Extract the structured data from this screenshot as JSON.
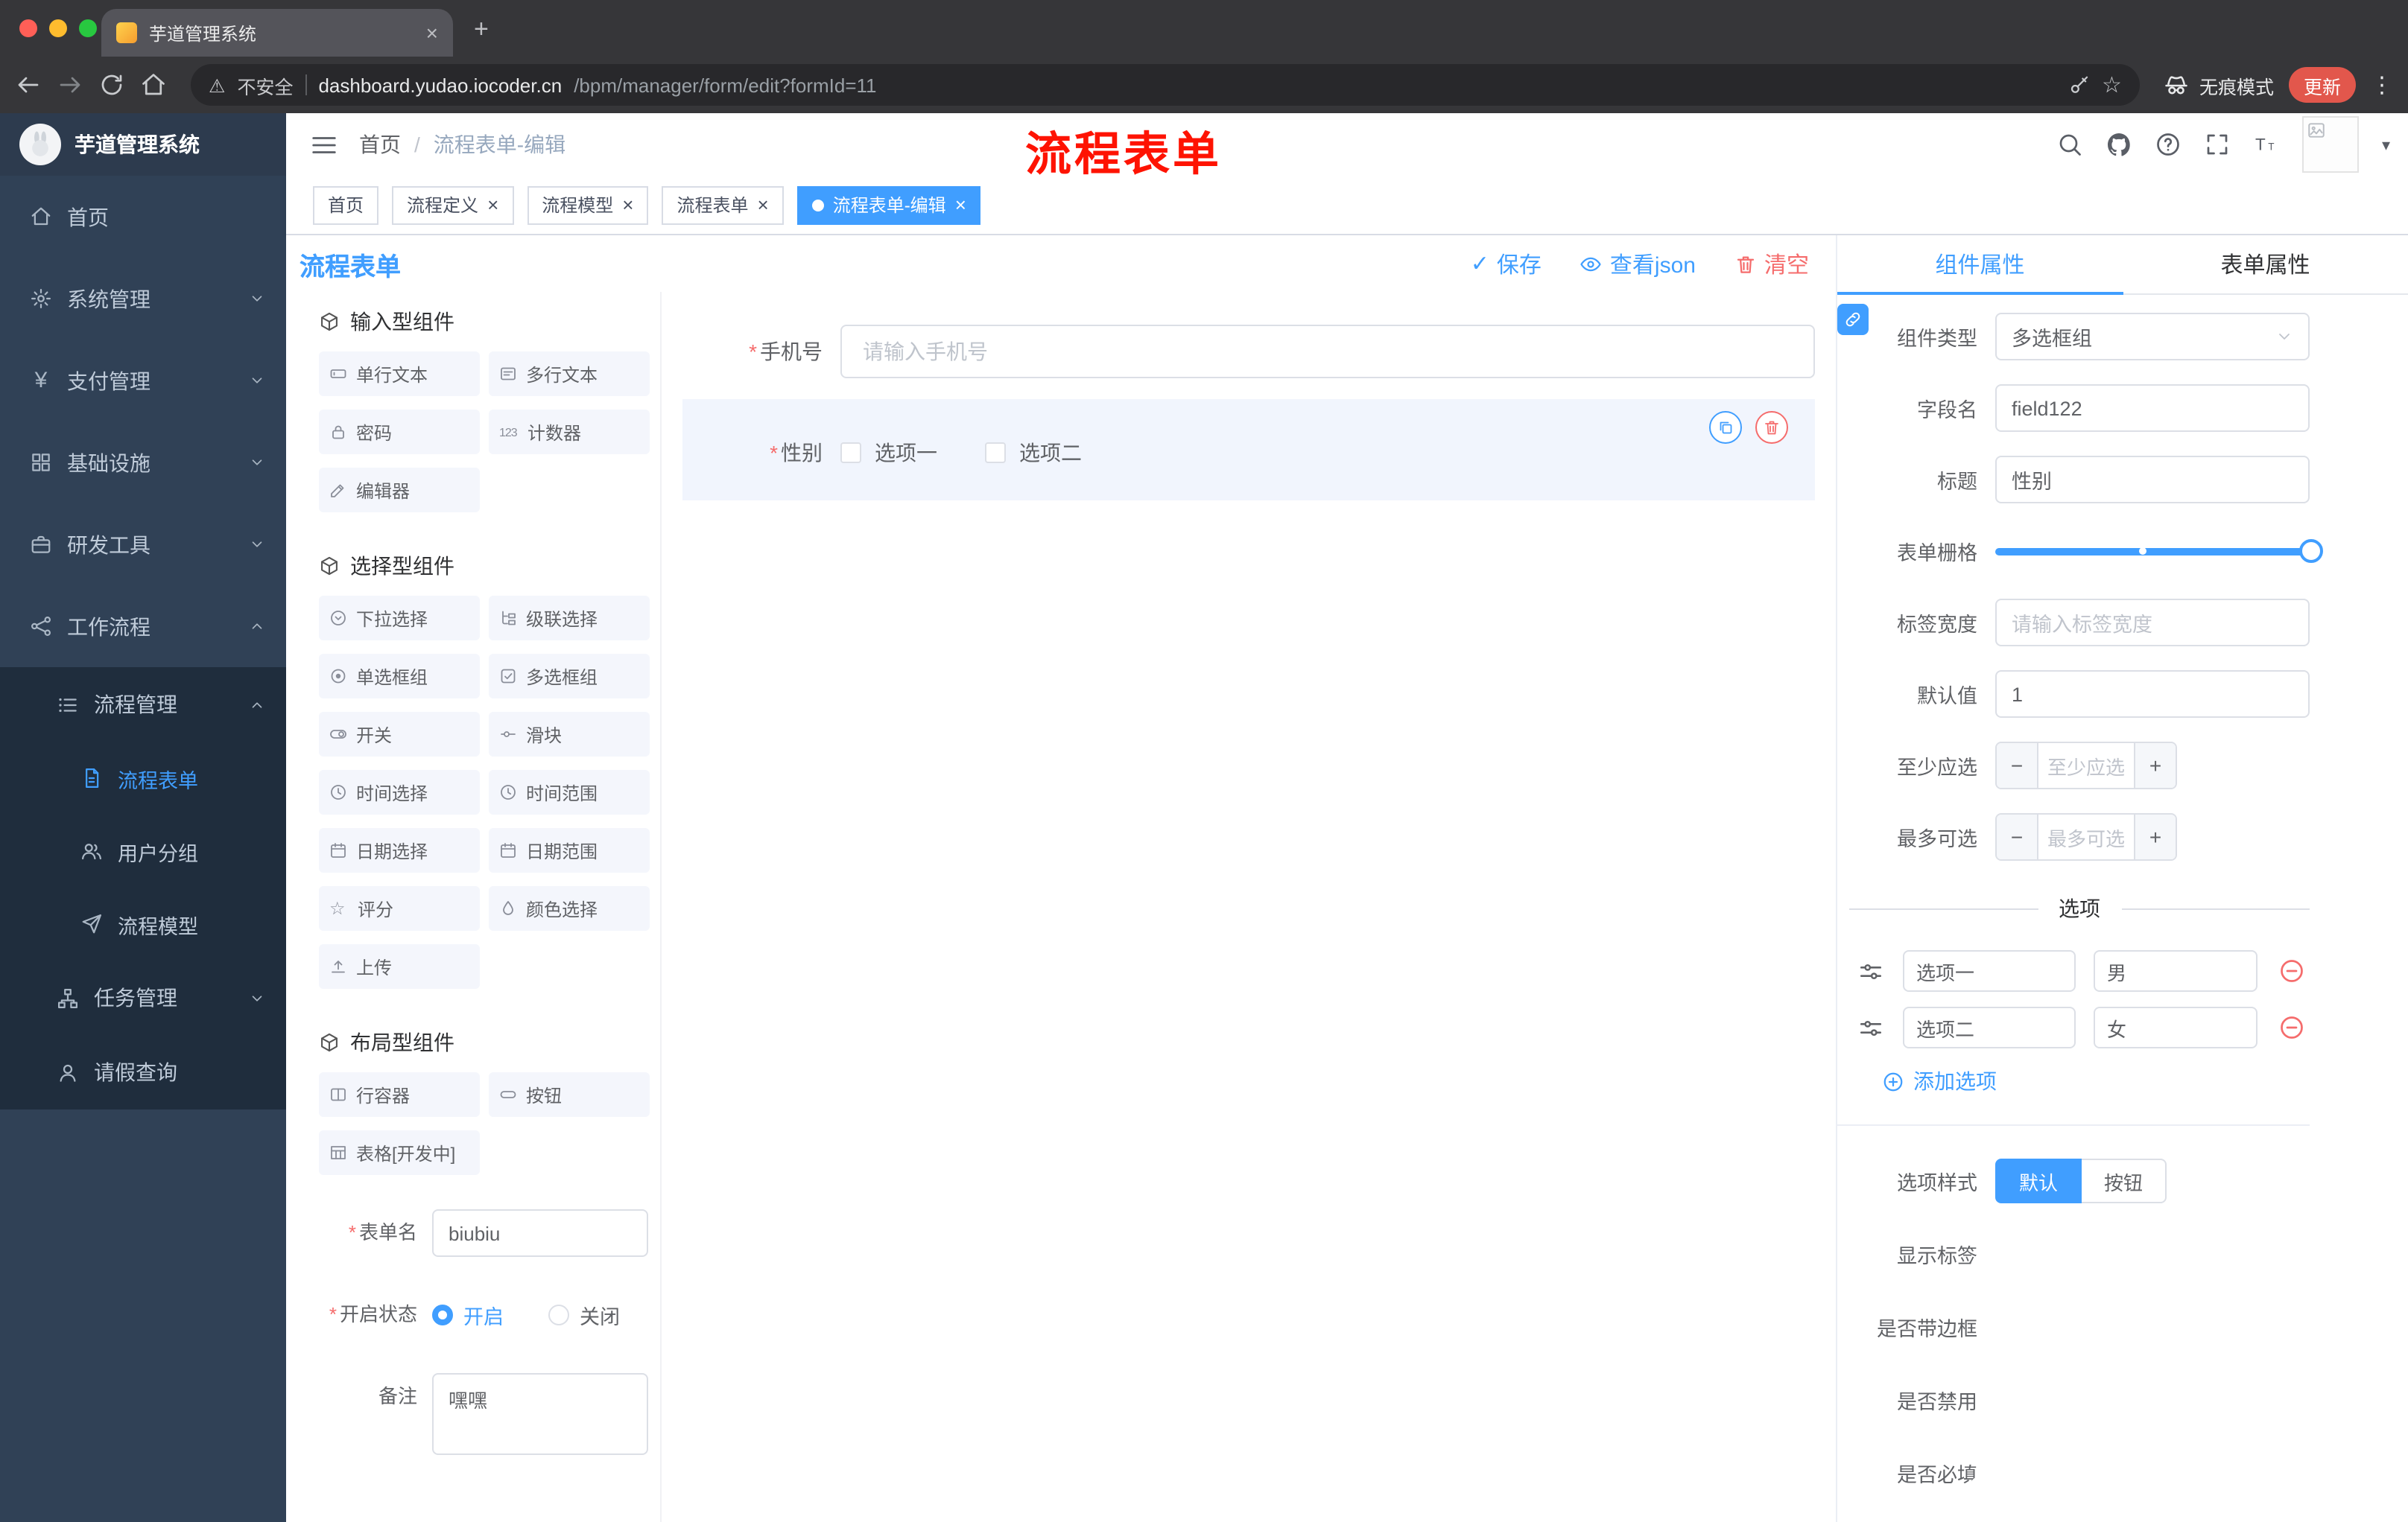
{
  "glyphs": {
    "warning": "⚠",
    "star": "☆",
    "dots": "⋮",
    "yen": "¥",
    "close": "×",
    "plus": "+",
    "minus": "−",
    "plus_btn": "+",
    "caret": "▾",
    "check": "✓",
    "slash": "/",
    "rate_star": "☆",
    "counter": "123"
  },
  "colors": {
    "accent": "#409EFF",
    "danger": "#F56C6C",
    "annotation": "#FE1302",
    "update_badge": "#E2574C"
  },
  "browser": {
    "tab_title": "芋道管理系统",
    "security_label": "不安全",
    "url_host": "dashboard.yudao.iocoder.cn",
    "url_path": "/bpm/manager/form/edit?formId=11",
    "incognito_label": "无痕模式",
    "update_label": "更新"
  },
  "sidebar": {
    "logo_title": "芋道管理系统",
    "menu": [
      "首页",
      "系统管理",
      "支付管理",
      "基础设施",
      "研发工具",
      "工作流程",
      "流程管理",
      "流程表单",
      "用户分组",
      "流程模型",
      "任务管理",
      "请假查询"
    ]
  },
  "header": {
    "breadcrumb_home": "首页",
    "breadcrumb_current": "流程表单-编辑",
    "annotation": "流程表单"
  },
  "tags": [
    "首页",
    "流程定义",
    "流程模型",
    "流程表单",
    "流程表单-编辑"
  ],
  "editor": {
    "title": "流程表单",
    "save": "保存",
    "view_json": "查看json",
    "clear": "清空"
  },
  "palette": {
    "section_input": "输入型组件",
    "section_select": "选择型组件",
    "section_layout": "布局型组件",
    "input_items": [
      "单行文本",
      "多行文本",
      "密码",
      "计数器",
      "编辑器"
    ],
    "select_items": [
      "下拉选择",
      "级联选择",
      "单选框组",
      "多选框组",
      "开关",
      "滑块",
      "时间选择",
      "时间范围",
      "日期选择",
      "日期范围",
      "评分",
      "颜色选择",
      "上传"
    ],
    "layout_items": [
      "行容器",
      "按钮",
      "表格[开发中]"
    ]
  },
  "form_settings": {
    "name_label": "表单名",
    "name_value": "biubiu",
    "status_label": "开启状态",
    "status_on": "开启",
    "status_off": "关闭",
    "remark_label": "备注",
    "remark_value": "嘿嘿"
  },
  "canvas": {
    "phone_label": "手机号",
    "phone_placeholder": "请输入手机号",
    "gender_label": "性别",
    "gender_option1": "选项一",
    "gender_option2": "选项二"
  },
  "props": {
    "tab_component": "组件属性",
    "tab_form": "表单属性",
    "type_label": "组件类型",
    "type_value": "多选框组",
    "field_label": "字段名",
    "field_value": "field122",
    "title_label": "标题",
    "title_value": "性别",
    "grid_label": "表单栅格",
    "width_label": "标签宽度",
    "width_placeholder": "请输入标签宽度",
    "default_label": "默认值",
    "default_value": "1",
    "min_label": "至少应选",
    "min_placeholder": "至少应选",
    "max_label": "最多可选",
    "max_placeholder": "最多可选",
    "options_title": "选项",
    "opt1_label": "选项一",
    "opt1_value": "男",
    "opt2_label": "选项二",
    "opt2_value": "女",
    "add_option": "添加选项",
    "style_label": "选项样式",
    "style_default": "默认",
    "style_button": "按钮",
    "switch_show_label": "显示标签",
    "switch_border": "是否带边框",
    "switch_disabled": "是否禁用",
    "switch_required": "是否必填"
  }
}
